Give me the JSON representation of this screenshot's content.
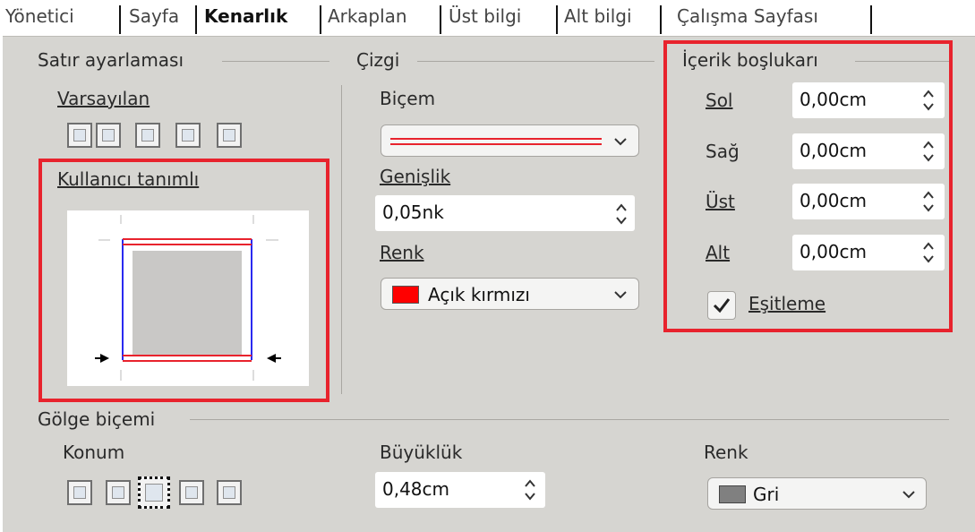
{
  "tabs": [
    "Yönetici",
    "Sayfa",
    "Kenarlık",
    "Arkaplan",
    "Üst bilgi",
    "Alt bilgi",
    "Çalışma Sayfası"
  ],
  "line_arrangement": {
    "title": "Satır ayarlaması",
    "default_label": "Varsayılan",
    "user_defined_label": "Kullanıcı tanımlı"
  },
  "line": {
    "title": "Çizgi",
    "style_label": "Biçem",
    "width_label": "Genişlik",
    "width_value": "0,05nk",
    "color_label": "Renk",
    "color_value": "Açık kırmızı",
    "color_hex": "#ff0000"
  },
  "padding": {
    "title": "İçerik boşlukarı",
    "left_label": "Sol",
    "left_value": "0,00cm",
    "right_label": "Sağ",
    "right_value": "0,00cm",
    "top_label": "Üst",
    "top_value": "0,00cm",
    "bottom_label": "Alt",
    "bottom_value": "0,00cm",
    "sync_label": "Eşitleme",
    "sync_checked": true
  },
  "shadow": {
    "title": "Gölge biçemi",
    "position_label": "Konum",
    "size_label": "Büyüklük",
    "size_value": "0,48cm",
    "color_label": "Renk",
    "color_value": "Gri",
    "color_hex": "#808080"
  },
  "colors": {
    "highlight": "#e8232d",
    "panel_bg": "#d6d5d1"
  }
}
